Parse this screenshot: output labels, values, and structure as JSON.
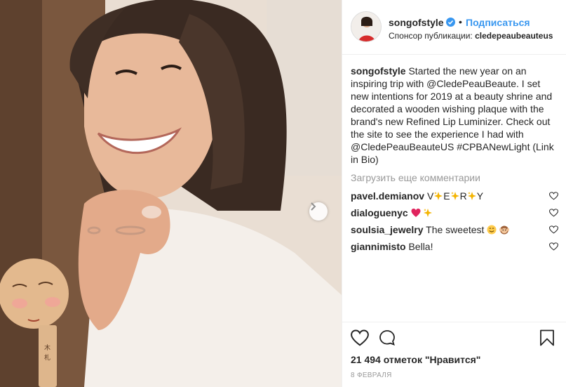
{
  "post": {
    "image_alt": "Smiling woman with bob haircut holding a round wooden mirror",
    "carousel_next_icon": "chevron-right-icon"
  },
  "header": {
    "username": "songofstyle",
    "verified_icon": "verified-badge-icon",
    "separator": "•",
    "follow_label": "Подписаться",
    "sponsor_prefix": "Спонсор публикации:",
    "sponsor_name": "cledepeaubeauteus"
  },
  "caption": {
    "username": "songofstyle",
    "text": "Started the new year on an inspiring trip with @CledePeauBeaute. I set new intentions for 2019 at a beauty shrine and decorated a wooden wishing plaque with the brand's new Refined Lip Luminizer. Check out the site to see the experience I had with @CledePeauBeauteUS #CPBANewLight (Link in Bio)"
  },
  "load_more_label": "Загрузить еще комментарии",
  "comments": [
    {
      "user": "pavel.demianov",
      "text_parts": [
        "V",
        "E",
        "R",
        "Y"
      ],
      "emoji": "sparkles-icon"
    },
    {
      "user": "dialoguenyc",
      "text": "",
      "emojis": [
        "red-heart-icon",
        "sparkles-icon"
      ]
    },
    {
      "user": "soulsia_jewelry",
      "text": "The sweetest",
      "emojis": [
        "smiling-face-icon",
        "hear-no-evil-monkey-icon"
      ]
    },
    {
      "user": "giannimisto",
      "text": "Bella!"
    }
  ],
  "actions": {
    "like_icon": "heart-outline-icon",
    "comment_icon": "comment-bubble-icon",
    "save_icon": "bookmark-icon"
  },
  "likes_text": "21 494 отметок \"Нравится\"",
  "date": "8 ФЕВРАЛЯ",
  "colors": {
    "link_blue": "#3897f0",
    "text": "#262626",
    "muted": "#999999",
    "border": "#efefef"
  }
}
